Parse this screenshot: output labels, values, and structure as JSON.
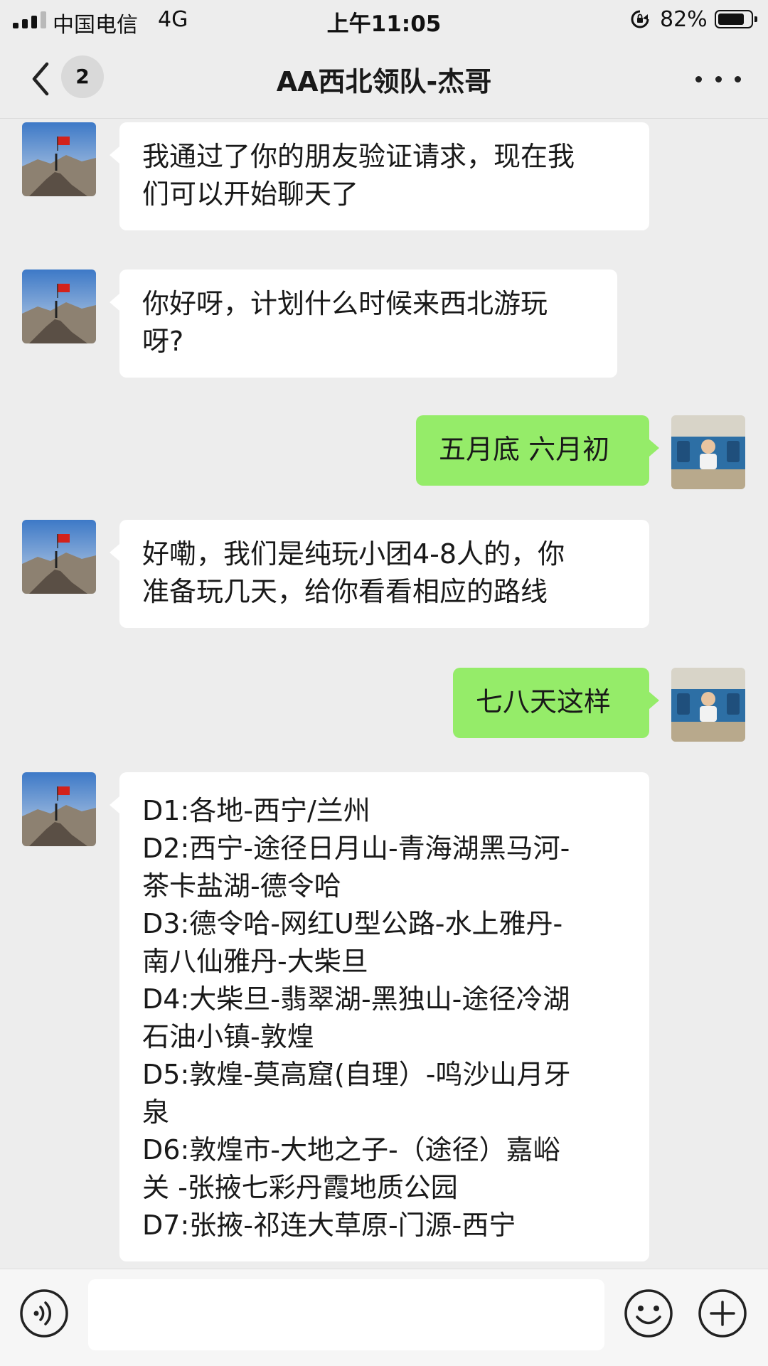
{
  "status_bar": {
    "carrier": "中国电信",
    "network": "4G",
    "time": "上午11:05",
    "battery_percent": "82%",
    "battery_level": 0.82
  },
  "header": {
    "unread_count": "2",
    "title": "AA西北领队-杰哥"
  },
  "messages": [
    {
      "side": "in",
      "text": "我通过了你的朋友验证请求，现在我\n们可以开始聊天了"
    },
    {
      "side": "in",
      "text": "你好呀，计划什么时候来西北游玩\n呀?"
    },
    {
      "side": "out",
      "text": "五月底 六月初"
    },
    {
      "side": "in",
      "text": "好嘞，我们是纯玩小团4-8人的，你\n准备玩几天，给你看看相应的路线"
    },
    {
      "side": "out",
      "text": "七八天这样"
    },
    {
      "side": "in",
      "text": "D1:各地-西宁/兰州\nD2:西宁-途径日月山-青海湖黑马河-\n茶卡盐湖-德令哈\nD3:德令哈-网红U型公路-水上雅丹-\n南八仙雅丹-大柴旦\nD4:大柴旦-翡翠湖-黑独山-途径冷湖\n石油小镇-敦煌\nD5:敦煌-莫高窟(自理）-鸣沙山月牙\n泉\nD6:敦煌市-大地之子-（途径）嘉峪\n关 -张掖七彩丹霞地质公园\nD7:张掖-祁连大草原-门源-西宁"
    }
  ],
  "input_bar": {
    "placeholder": ""
  },
  "icons": {
    "back": "chevron-left-icon",
    "more": "more-dots-icon",
    "voice": "voice-icon",
    "emoji": "emoji-icon",
    "plus": "plus-icon",
    "rotation_lock": "rotation-lock-icon"
  },
  "colors": {
    "background": "#ededed",
    "incoming_bubble": "#ffffff",
    "outgoing_bubble": "#95ec69",
    "text": "#191919"
  }
}
